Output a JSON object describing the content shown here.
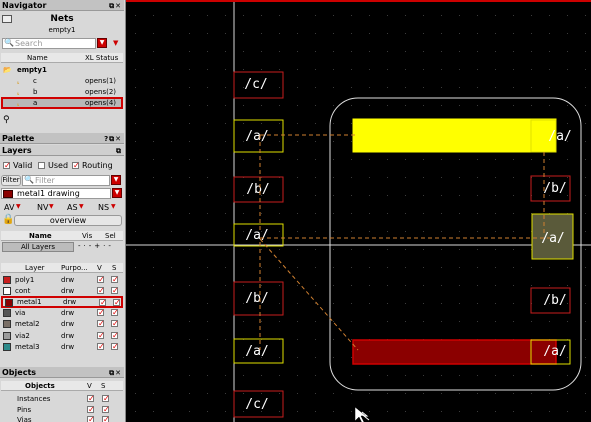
{
  "navigator": {
    "title": "Navigator",
    "heading": "Nets",
    "subheading": "empty1",
    "search_placeholder": "Search",
    "columns": [
      "Name",
      "XL Status"
    ],
    "root": "empty1",
    "nets": [
      {
        "name": "c",
        "status": "opens(1)"
      },
      {
        "name": "b",
        "status": "opens(2)"
      },
      {
        "name": "a",
        "status": "opens(4)"
      }
    ]
  },
  "palette": {
    "title": "Palette"
  },
  "layers": {
    "title": "Layers",
    "filters": [
      {
        "label": "Valid",
        "checked": true
      },
      {
        "label": "Used",
        "checked": false
      },
      {
        "label": "Routing",
        "checked": true
      }
    ],
    "filter_label": "Filter",
    "filter_placeholder": "Filter",
    "current_layer": "metal1 drawing",
    "vis_toggles": [
      "AV",
      "NV",
      "AS",
      "NS"
    ],
    "overview_label": "overview",
    "sets_columns": [
      "Name",
      "Vis",
      "Sel"
    ],
    "all_layers_label": "All Layers",
    "list_columns": [
      "Layer",
      "Purpo...",
      "V",
      "S"
    ],
    "list": [
      {
        "name": "poly1",
        "purpose": "drw",
        "color": "#c81e1e"
      },
      {
        "name": "cont",
        "purpose": "drw",
        "color": "#ffffff"
      },
      {
        "name": "metal1",
        "purpose": "drw",
        "color": "#8b0000"
      },
      {
        "name": "via",
        "purpose": "drw",
        "color": "#555555"
      },
      {
        "name": "metal2",
        "purpose": "drw",
        "color": "#7a6f66"
      },
      {
        "name": "via2",
        "purpose": "drw",
        "color": "#9a9a9a"
      },
      {
        "name": "metal3",
        "purpose": "drw",
        "color": "#2e8b8b"
      }
    ]
  },
  "objects": {
    "title": "Objects",
    "columns": [
      "Objects",
      "V",
      "S"
    ],
    "items": [
      "Instances",
      "Pins",
      "Vias"
    ]
  },
  "canvas_pins": [
    "/c/",
    "/a/",
    "/b/",
    "/a/",
    "/b/",
    "/a/",
    "/c/",
    "/a/",
    "/b/",
    "/a/",
    "/b/",
    "/a/"
  ],
  "colors": {
    "pin_border": "#e0e000",
    "pin_border_red": "#c81e1e",
    "metal1": "#ffff00",
    "metal1_dark": "#8b0000",
    "selection": "#d00000",
    "flight_line": "#d08030"
  }
}
